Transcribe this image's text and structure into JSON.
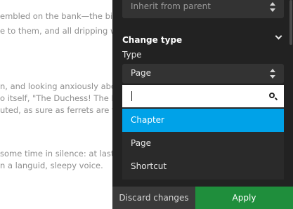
{
  "document": {
    "lines": [
      "embled on the bank—the bird",
      "e to them, and all dripping we",
      "n, and looking anxiously about",
      "o itself, \"The Duchess! The Du",
      "uted, as sure as ferrets are fe",
      "some time in silence: at last th",
      "n a languid, sleepy voice."
    ]
  },
  "panel": {
    "inherit_select_value": "Inherit from parent",
    "section_title": "Change type",
    "type_label": "Type",
    "type_select_value": "Page",
    "search": {
      "value": ""
    },
    "options": [
      {
        "label": "Chapter",
        "selected": true
      },
      {
        "label": "Page",
        "selected": false
      },
      {
        "label": "Shortcut",
        "selected": false
      }
    ],
    "discard_label": "Discard changes",
    "apply_label": "Apply"
  },
  "colors": {
    "panel_bg": "#222222",
    "select_bg": "#333333",
    "selected_option": "#00a2e8",
    "apply_button": "#1f8e3c",
    "discard_button": "#3a3a3a"
  }
}
